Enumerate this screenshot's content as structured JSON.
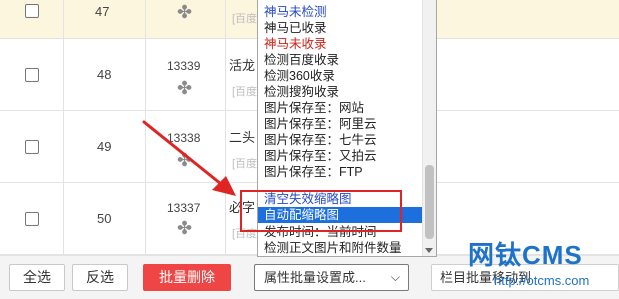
{
  "rows": [
    {
      "id": "47",
      "num": "",
      "title": "",
      "tag": "[百度]"
    },
    {
      "id": "48",
      "num": "13339",
      "title": "活龙",
      "tag": "[百度]"
    },
    {
      "id": "49",
      "num": "13338",
      "title": "二头",
      "tag": "[百度]"
    },
    {
      "id": "50",
      "num": "13337",
      "title": "必字",
      "tag": "[百度]"
    }
  ],
  "dropdown": {
    "options": [
      {
        "label": "神马未检测",
        "color": "blue"
      },
      {
        "label": "神马已收录",
        "color": "normal"
      },
      {
        "label": "神马未收录",
        "color": "red"
      },
      {
        "label": "检测百度收录",
        "color": "normal"
      },
      {
        "label": "检测360收录",
        "color": "normal"
      },
      {
        "label": "检测搜狗收录",
        "color": "normal"
      },
      {
        "label": "图片保存至：网站",
        "color": "normal"
      },
      {
        "label": "图片保存至：阿里云",
        "color": "normal"
      },
      {
        "label": "图片保存至：七牛云",
        "color": "normal"
      },
      {
        "label": "图片保存至：又拍云",
        "color": "normal"
      },
      {
        "label": "图片保存至：FTP",
        "color": "normal"
      },
      {
        "label": "清空失效缩略图",
        "color": "blue"
      },
      {
        "label": "自动配缩略图",
        "color": "selected"
      },
      {
        "label": "发布时间：当前时间",
        "color": "normal"
      },
      {
        "label": "检测正文图片和附件数量",
        "color": "normal"
      }
    ]
  },
  "toolbar": {
    "select_all": "全选",
    "invert": "反选",
    "batch_delete": "批量删除",
    "attr_select": "属性批量设置成...",
    "column_select": "栏目批量移动到"
  },
  "watermark": {
    "title": "网钛CMS",
    "url": "http://otcms.com"
  },
  "icons": {
    "row_icon": "puzzle-icon",
    "arrow": "red-arrow-icon",
    "dropdown_chevron": "chevron-down-icon"
  },
  "colors": {
    "accent_red": "#f04545",
    "selection_blue": "#1e6fde",
    "highlight_red": "#e02424",
    "row_hover_yellow": "#fdf6df"
  }
}
